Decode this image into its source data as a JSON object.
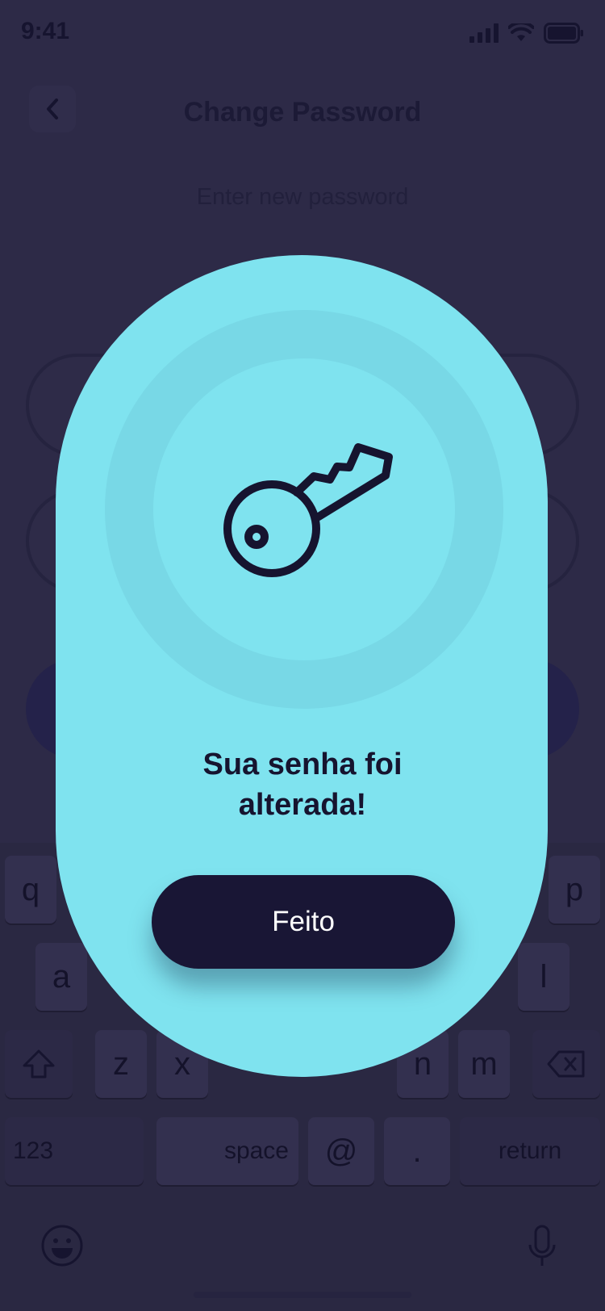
{
  "status_bar": {
    "time": "9:41"
  },
  "page": {
    "title": "Change Password",
    "subtitle": "Enter new password"
  },
  "keyboard": {
    "row1": [
      {
        "label": "q",
        "name": "key-q"
      },
      {
        "label": "p",
        "name": "key-p"
      }
    ],
    "row2": [
      {
        "label": "a",
        "name": "key-a"
      },
      {
        "label": "l",
        "name": "key-l"
      }
    ],
    "row3": [
      {
        "label": "z",
        "name": "key-z"
      },
      {
        "label": "x",
        "name": "key-x"
      },
      {
        "label": "n",
        "name": "key-n"
      },
      {
        "label": "m",
        "name": "key-m"
      }
    ],
    "numbers_label": "123",
    "space_label": "space",
    "at_label": "@",
    "dot_label": ".",
    "return_label": "return"
  },
  "modal": {
    "icon": "key-icon",
    "message_line1": "Sua senha foi",
    "message_line2": "alterada!",
    "button_label": "Feito"
  },
  "colors": {
    "overlay_background": "#2d2a47",
    "modal_background": "#7fe3ef",
    "halo": "#78d8e6",
    "button_background": "#191635",
    "ink": "#16142f"
  }
}
